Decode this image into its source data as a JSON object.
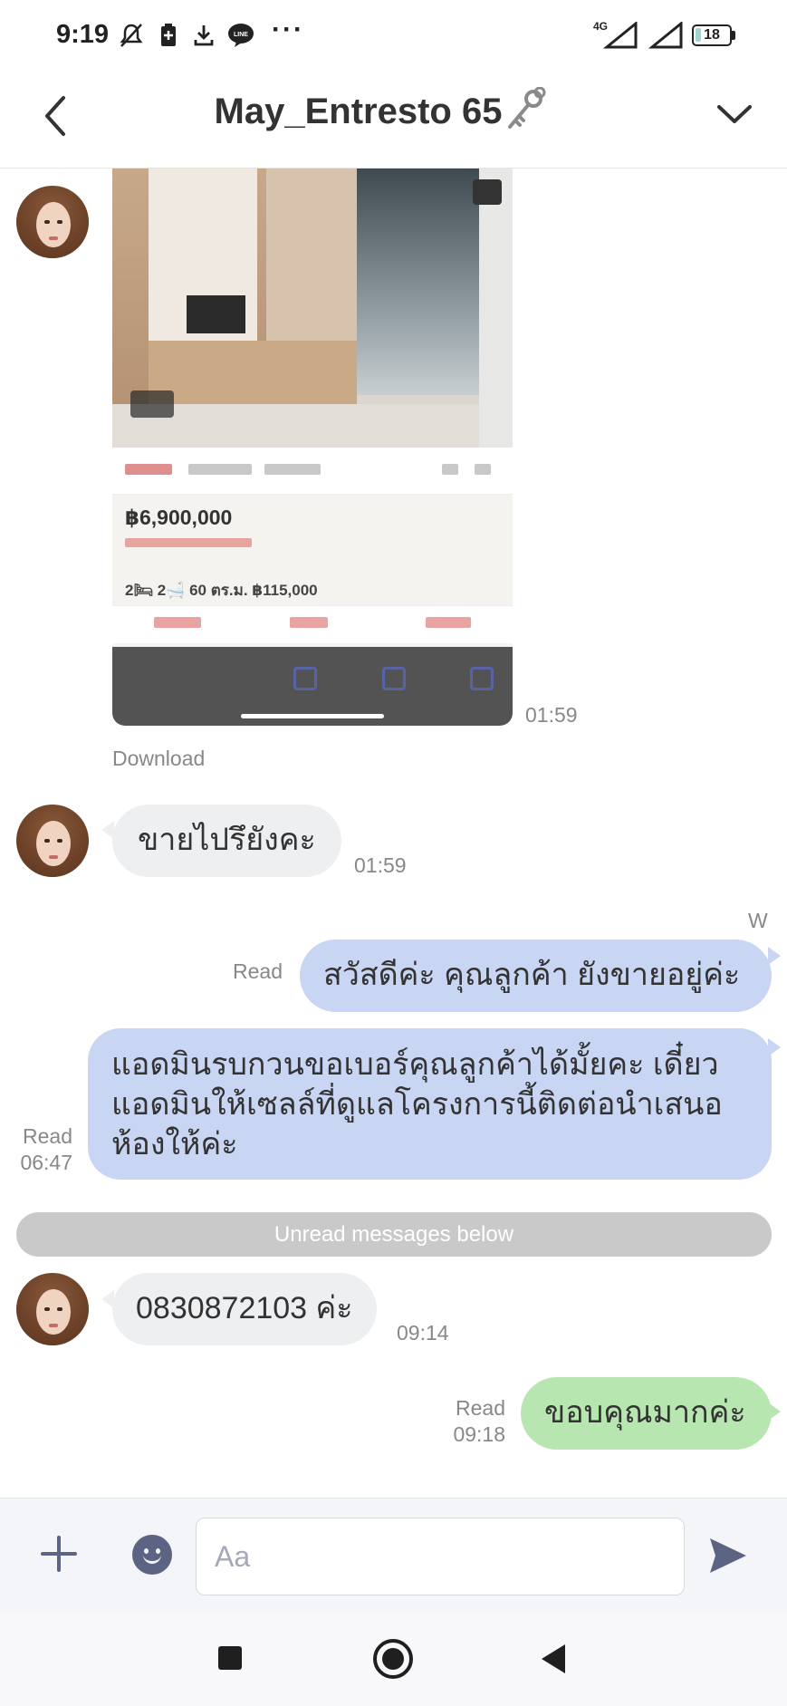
{
  "status_bar": {
    "time": "9:19",
    "network": "4G",
    "battery": "18",
    "battery_percent": 18,
    "icons": [
      "mute-icon",
      "battery-saver-icon",
      "download-icon",
      "line-app-icon",
      "more-icon",
      "signal-icon",
      "signal-icon",
      "battery-icon"
    ]
  },
  "header": {
    "title": "May_Entresto 65",
    "title_icon": "key-icon",
    "back_icon": "chevron-left-icon",
    "menu_icon": "chevron-down-icon"
  },
  "messages": {
    "image_time": "01:59",
    "image": {
      "price": "฿6,900,000",
      "specs": "2🛏 2🛁 60 ตร.ม. ฿115,000"
    },
    "download_label": "Download",
    "msg1": {
      "text": "ขายไปรึยังคะ",
      "time": "01:59"
    },
    "sender_name": "W",
    "msg2": {
      "text": "สวัสดีค่ะ คุณลูกค้า ยังขายอยู่ค่ะ",
      "status": "Read"
    },
    "msg3": {
      "line1": "แอดมินรบกวนขอเบอร์คุณลูกค้าได้มั้ยคะ เดี๋ยว",
      "line2": "แอดมินให้เซลล์ที่ดูแลโครงการนี้ติดต่อนำเสนอ",
      "line3": "ห้องให้ค่ะ",
      "status": "Read",
      "time": "06:47"
    },
    "unread_divider": "Unread messages below",
    "msg4": {
      "text": "0830872103 ค่ะ",
      "time": "09:14"
    },
    "msg5": {
      "text": "ขอบคุณมากค่ะ",
      "status": "Read",
      "time": "09:18"
    }
  },
  "input_bar": {
    "placeholder": "Aa",
    "value": ""
  },
  "colors": {
    "incoming_bubble": "#eeeff1",
    "outgoing_bubble": "#c8d5f3",
    "outgoing_green": "#b8e6b1",
    "unread_divider": "#c9c9c9",
    "accent": "#5c6383"
  }
}
